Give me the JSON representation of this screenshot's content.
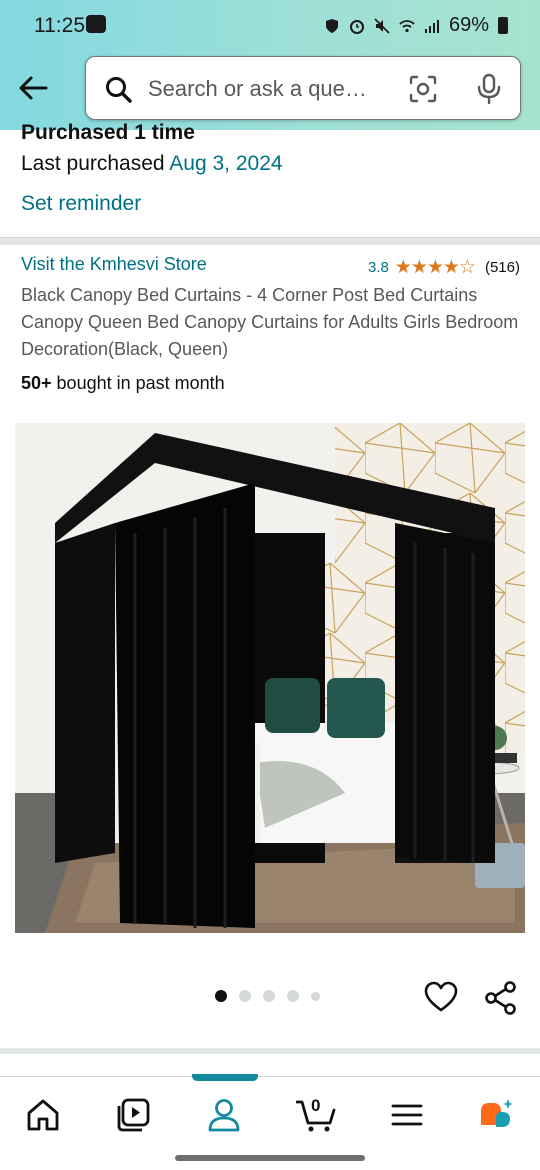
{
  "status_bar": {
    "time": "11:25",
    "battery": "69%"
  },
  "search": {
    "placeholder": "Search or ask a que…"
  },
  "purchase": {
    "count_text": "Purchased 1 time",
    "last_label": "Last purchased ",
    "last_date": "Aug 3, 2024",
    "reminder": "Set reminder"
  },
  "product": {
    "store": "Visit the Kmhesvi Store",
    "rating": "3.8",
    "stars": 3.8,
    "review_count": "(516)",
    "title": "Black Canopy Bed Curtains - 4 Corner Post Bed Curtains Canopy Queen Bed Canopy Curtains for Adults Girls Bedroom Decoration(Black, Queen)",
    "bought_bold": "50+",
    "bought_rest": " bought in past month"
  },
  "carousel": {
    "total": 5,
    "active": 1
  },
  "nav": {
    "cart_count": "0",
    "items": [
      "home-icon",
      "video-icon",
      "account-icon",
      "cart-icon",
      "menu-icon",
      "rufus-icon"
    ],
    "active": "account-icon"
  },
  "colors": {
    "link": "#007185",
    "star": "#de7921",
    "accent": "#138a9d",
    "header_gradient_start": "#84d8e1",
    "header_gradient_end": "#a6e3cf"
  }
}
